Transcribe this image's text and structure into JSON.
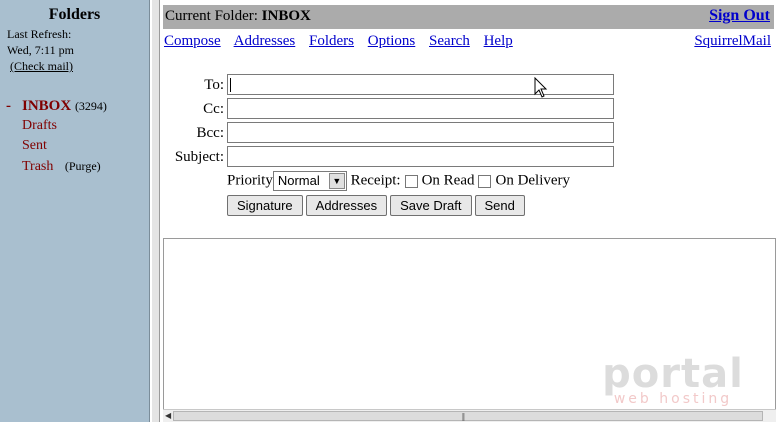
{
  "folders_pane": {
    "title": "Folders",
    "last_refresh_label": "Last Refresh:",
    "last_refresh_time": "Wed, 7:11 pm",
    "check_mail": "(Check mail)",
    "inbox": {
      "label": "INBOX",
      "count": "(3294)",
      "marker": "-"
    },
    "drafts": "Drafts",
    "sent": "Sent",
    "trash": "Trash",
    "purge": "(Purge)"
  },
  "header": {
    "current_folder_label": "Current Folder:",
    "current_folder_value": "INBOX",
    "sign_out": "Sign Out"
  },
  "nav": {
    "compose": "Compose",
    "addresses": "Addresses",
    "folders": "Folders",
    "options": "Options",
    "search": "Search",
    "help": "Help",
    "squirrelmail": "SquirrelMail"
  },
  "compose_form": {
    "to_label": "To:",
    "cc_label": "Cc:",
    "bcc_label": "Bcc:",
    "subject_label": "Subject:",
    "to_value": "",
    "cc_value": "",
    "bcc_value": "",
    "subject_value": "",
    "priority_label": "Priority",
    "priority_value": "Normal",
    "receipt_label": "Receipt:",
    "on_read_label": "On Read",
    "on_delivery_label": "On Delivery",
    "on_read_checked": false,
    "on_delivery_checked": false
  },
  "buttons": {
    "signature": "Signature",
    "addresses": "Addresses",
    "save_draft": "Save Draft",
    "send": "Send"
  },
  "watermark": {
    "line1": "portal",
    "line2": "web hosting"
  },
  "colors": {
    "folder_pane": "#a9bfcf",
    "link": "#0000cc",
    "folder_link": "#800000",
    "header_bar": "#ababab"
  }
}
